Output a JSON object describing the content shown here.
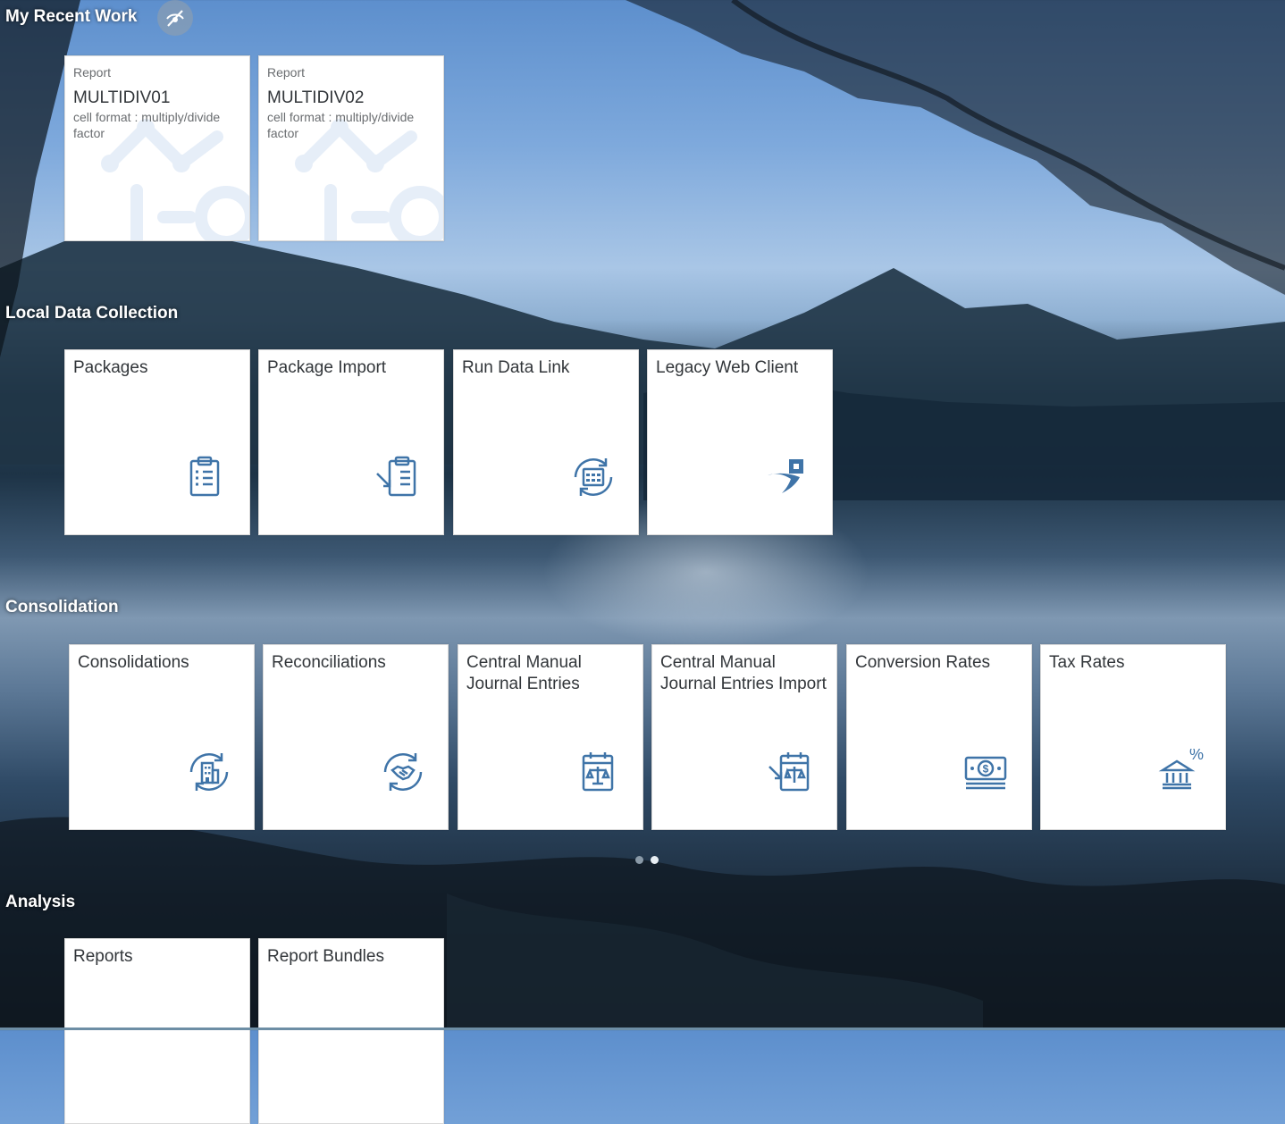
{
  "groups": {
    "recent": {
      "title": "My Recent Work"
    },
    "local": {
      "title": "Local Data Collection"
    },
    "consolidation": {
      "title": "Consolidation"
    },
    "analysis": {
      "title": "Analysis"
    }
  },
  "recent_tiles": [
    {
      "type": "Report",
      "name": "MULTIDIV01",
      "desc": "cell format : multiply/divide factor"
    },
    {
      "type": "Report",
      "name": "MULTIDIV02",
      "desc": "cell format : multiply/divide factor"
    }
  ],
  "local_tiles": [
    {
      "title": "Packages",
      "icon": "clipboard-list-icon"
    },
    {
      "title": "Package Import",
      "icon": "clipboard-import-icon"
    },
    {
      "title": "Run Data Link",
      "icon": "calendar-sync-icon"
    },
    {
      "title": "Legacy Web Client",
      "icon": "legacy-client-icon"
    }
  ],
  "consolidation_tiles": [
    {
      "title": "Consolidations",
      "icon": "building-sync-icon"
    },
    {
      "title": "Reconciliations",
      "icon": "handshake-sync-icon"
    },
    {
      "title": "Central Manual Journal Entries",
      "icon": "calendar-scale-icon"
    },
    {
      "title": "Central Manual Journal Entries Import",
      "icon": "calendar-scale-import-icon"
    },
    {
      "title": "Conversion Rates",
      "icon": "money-bills-icon"
    },
    {
      "title": "Tax Rates",
      "icon": "bank-percent-icon"
    }
  ],
  "analysis_tiles": [
    {
      "title": "Reports"
    },
    {
      "title": "Report Bundles"
    }
  ],
  "pager": {
    "pages": 2,
    "active": 2
  },
  "colors": {
    "icon": "#3f74a8",
    "tile_bg": "#ffffff",
    "title_text": "#ffffff",
    "watermark": "#e6eef8"
  }
}
